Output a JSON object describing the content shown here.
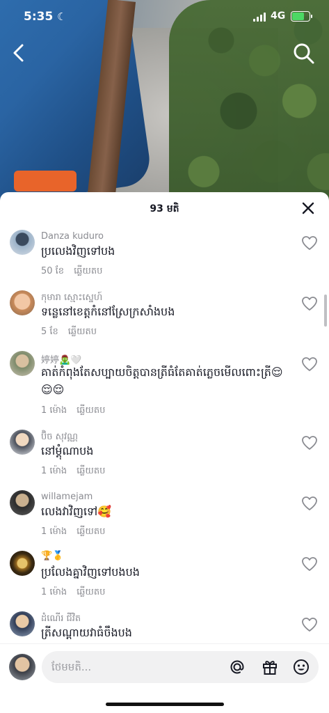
{
  "status_bar": {
    "time": "5:35",
    "network": "4G"
  },
  "sheet": {
    "comment_count": "93 មតិ"
  },
  "comments": [
    {
      "username": "Danza kuduro",
      "text": "ប្រលេងវិញទៅបង",
      "time": "50 ខែ",
      "reply": "ឆ្លើយតប"
    },
    {
      "username": "កុមារា ស្មោះស្នេហ៍",
      "text": "ទន្លេនៅខេត្តកំនៅស្រែក្រសាំងបង",
      "time": "5 ខែ",
      "reply": "ឆ្លើយតប"
    },
    {
      "username": "婷婷🧟‍♂️🤍",
      "text": "គាត់កំពុងតែសប្បាយចិត្តបានត្រីធំតែគាត់ភ្លេចមើលពោះត្រី😌😌😌",
      "time": "1 ម៉ោង",
      "reply": "ឆ្លើយតប"
    },
    {
      "username": "ប៊ិច សុវណ្ណ",
      "text": "នៅម្តុំណាបង",
      "time": "1 ម៉ោង",
      "reply": "ឆ្លើយតប"
    },
    {
      "username": "willamejam",
      "text": "លេងវាវិញទៅ🥰",
      "time": "1 ម៉ោង",
      "reply": "ឆ្លើយតប"
    },
    {
      "username": "🏆🥇",
      "text": "ប្រលែងគ្នាវិញទៅបងបង",
      "time": "1 ម៉ោង",
      "reply": "ឆ្លើយតប"
    },
    {
      "username": "ដំណើរ ជីវិត",
      "text": "ត្រីសណ្តាយវាធំចឹងបង",
      "time": "",
      "reply": ""
    }
  ],
  "input": {
    "placeholder": "ថែមមតិ..."
  },
  "icons": {
    "back": "chevron-left-icon",
    "search": "search-icon",
    "close": "close-icon",
    "like": "heart-icon",
    "mention": "at-icon",
    "gift": "gift-icon",
    "emoji": "emoji-icon"
  },
  "colors": {
    "battery": "#4cd964",
    "text": "#161823",
    "muted": "#8a8b91"
  }
}
